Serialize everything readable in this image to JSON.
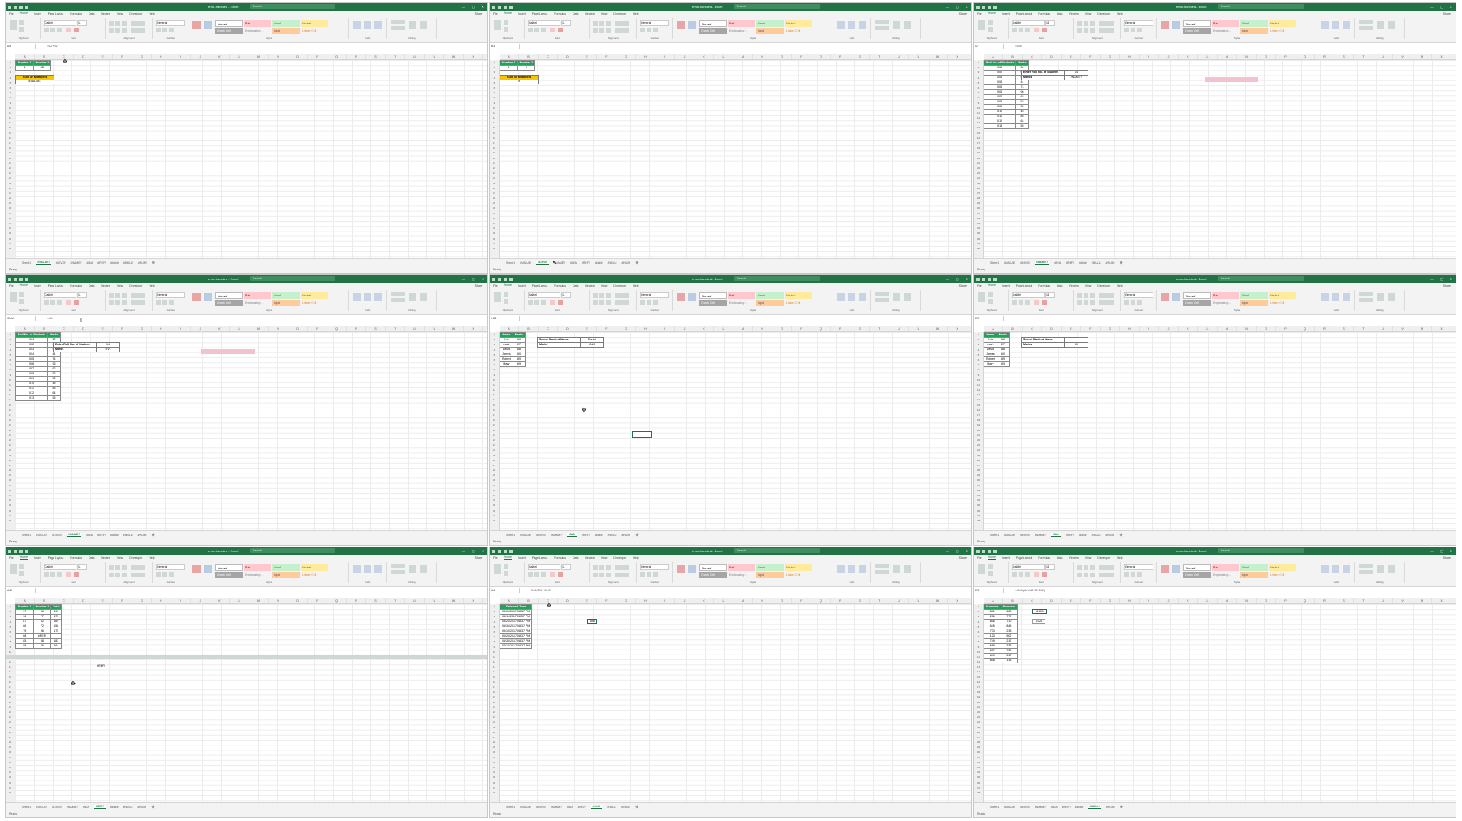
{
  "app": {
    "title": "error-handled - Excel",
    "search_placeholder": "Search",
    "window_buttons": [
      "—",
      "▢",
      "✕"
    ],
    "menu": [
      "File",
      "Home",
      "Insert",
      "Page Layout",
      "Formulas",
      "Data",
      "Review",
      "View",
      "Developer",
      "Help"
    ],
    "share": "Share",
    "ribbon_groups": [
      "Clipboard",
      "Font",
      "Alignment",
      "Number",
      "Styles",
      "Cells",
      "Editing"
    ],
    "font_name": "Calibri",
    "font_size": "11",
    "number_format": "General",
    "styles": [
      "Normal",
      "Bad",
      "Good",
      "Neutral",
      "Calculation",
      "Check Cell",
      "Explanatory ...",
      "Input",
      "Linked Cell",
      "Note"
    ],
    "cells_buttons": [
      "Insert",
      "Delete",
      "Format"
    ],
    "editing_items": [
      "AutoSum",
      "Fill",
      "Clear",
      "Sort & Filter",
      "Find & Select"
    ],
    "columns": [
      "A",
      "B",
      "C",
      "D",
      "E",
      "F",
      "G",
      "H",
      "I",
      "J",
      "K",
      "L",
      "M",
      "N",
      "O",
      "P",
      "Q",
      "R",
      "S",
      "T",
      "U",
      "V",
      "W",
      "X",
      "Y"
    ],
    "tabs": [
      "Sheet1",
      "#VALUE!",
      "#DIV/0!",
      "#NAME?",
      "#N/A",
      "#REF!",
      "#####",
      "#NULL!",
      "#NUM!"
    ],
    "status": "Ready"
  },
  "panes": [
    {
      "id": "p1",
      "namebox": "A5",
      "formula": "=A2+B2",
      "active_tab": "#VALUE!",
      "table": {
        "headers": [
          "Number 1",
          "Number 2"
        ],
        "rows": [
          [
            "4",
            "5B"
          ]
        ]
      },
      "result_label": "Sum of Numbers",
      "result_value": "#VALUE!"
    },
    {
      "id": "p2",
      "namebox": "B3",
      "formula": "",
      "active_tab": "#DIV/0!",
      "table": {
        "headers": [
          "Number 1",
          "Number 2"
        ],
        "rows": [
          [
            "4",
            "5"
          ]
        ]
      },
      "result_label": "Sum of Numbers",
      "result_value": "9"
    },
    {
      "id": "p3",
      "namebox": "I2",
      "formula": "=N/A",
      "active_tab": "#NAME?",
      "table": {
        "headers": [
          "Roll No. of Students",
          "Marks"
        ],
        "rows": [
          [
            "001",
            "52"
          ],
          [
            "002",
            "63"
          ],
          [
            "003",
            "98"
          ],
          [
            "004",
            "41"
          ],
          [
            "005",
            "74"
          ],
          [
            "006",
            "96"
          ],
          [
            "007",
            "62"
          ],
          [
            "008",
            "52"
          ],
          [
            "009",
            "32"
          ],
          [
            "010",
            "45"
          ],
          [
            "011",
            "85"
          ],
          [
            "012",
            "64"
          ],
          [
            "013",
            "55"
          ]
        ]
      },
      "lookup": [
        [
          "Enter Roll No. of Student",
          "14"
        ],
        [
          "Marks",
          "#NAME?"
        ]
      ]
    },
    {
      "id": "p4",
      "namebox": "SUM",
      "formula": "=IVL",
      "active_tab": "#NAME?",
      "table": {
        "headers": [
          "Roll No. of Students",
          "Marks"
        ],
        "rows": [
          [
            "001",
            "52"
          ],
          [
            "002",
            "63"
          ],
          [
            "003",
            "98"
          ],
          [
            "004",
            "41"
          ],
          [
            "005",
            "74"
          ],
          [
            "006",
            "96"
          ],
          [
            "007",
            "62"
          ],
          [
            "008",
            "52"
          ],
          [
            "009",
            "32"
          ],
          [
            "010",
            "45"
          ],
          [
            "011",
            "85"
          ],
          [
            "012",
            "64"
          ],
          [
            "013",
            "55"
          ]
        ]
      },
      "lookup": [
        [
          "Enter Roll No. of Student",
          "14"
        ],
        [
          "Marks",
          "=IVL"
        ]
      ]
    },
    {
      "id": "p5",
      "namebox": "H21",
      "formula": "",
      "active_tab": "#N/A",
      "table": {
        "headers": [
          "Name",
          "Marks"
        ],
        "rows": [
          [
            "Eric",
            "60"
          ],
          [
            "mark",
            "27"
          ],
          [
            "David",
            "88"
          ],
          [
            "James",
            "60"
          ],
          [
            "Robert",
            "89"
          ],
          [
            "Mary",
            "69"
          ]
        ]
      },
      "lookup": [
        [
          "Select Student Name",
          "Daniel"
        ],
        [
          "Marks",
          "#N/A"
        ]
      ]
    },
    {
      "id": "p6",
      "namebox": "E2",
      "formula": "",
      "active_tab": "#N/A",
      "table": {
        "headers": [
          "Name",
          "Marks"
        ],
        "rows": [
          [
            "Eric",
            "60"
          ],
          [
            "mark",
            "27"
          ],
          [
            "David",
            "88"
          ],
          [
            "James",
            "60"
          ],
          [
            "Robert",
            "89"
          ],
          [
            "Mary",
            "69"
          ]
        ]
      },
      "lookup": [
        [
          "Select Student Name",
          ""
        ],
        [
          "Marks",
          "60"
        ]
      ]
    },
    {
      "id": "p7",
      "namebox": "A12",
      "formula": "",
      "active_tab": "#REF!",
      "table": {
        "headers": [
          "Number 1",
          "Number 2",
          "Total"
        ],
        "rows": [
          [
            "97",
            "96",
            "193"
          ],
          [
            "96",
            "77",
            "173"
          ],
          [
            "87",
            "82",
            "169"
          ],
          [
            "86",
            "72",
            "158"
          ],
          [
            "79",
            "96",
            "175"
          ],
          [
            "68",
            "#REF!",
            ""
          ],
          [
            "85",
            "98",
            "183"
          ],
          [
            "88",
            "76",
            "164"
          ]
        ]
      },
      "floating": "#REF!"
    },
    {
      "id": "p8",
      "namebox": "A4",
      "formula": "5/11/2017 08:37",
      "active_tab": "#####",
      "table": {
        "headers": [
          "Date and Time"
        ],
        "rows": [
          [
            "05/01/2017 08:37 PM"
          ],
          [
            "05/11/2017 08:37 PM"
          ],
          [
            "05/21/2017 08:37 PM"
          ],
          [
            "05/31/2017 08:37 PM"
          ],
          [
            "06/10/2017 08:37 PM"
          ],
          [
            "06/20/2017 08:37 PM"
          ],
          [
            "06/30/2017 08:37 PM"
          ],
          [
            "07/10/2017 08:37 PM"
          ]
        ]
      },
      "floating": "###"
    },
    {
      "id": "p9",
      "namebox": "E3",
      "formula": "=SUM(A2:A12 B2:B12)",
      "active_tab": "#NULL!",
      "table": {
        "headers": [
          "Numbers",
          "Numbers"
        ],
        "rows": [
          [
            "871",
            "622"
          ],
          [
            "206",
            "777"
          ],
          [
            "806",
            "730"
          ],
          [
            "645",
            "846"
          ],
          [
            "773",
            "238"
          ],
          [
            "123",
            "502"
          ],
          [
            "749",
            "217"
          ],
          [
            "698",
            "338"
          ],
          [
            "877",
            "730"
          ],
          [
            "640",
            "517"
          ],
          [
            "808",
            "138"
          ]
        ]
      },
      "results": [
        "11639",
        "6125"
      ]
    }
  ]
}
